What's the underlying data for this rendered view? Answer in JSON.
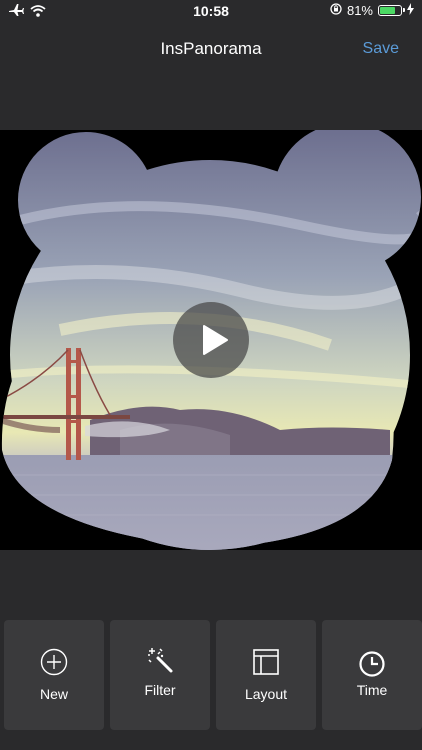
{
  "status_bar": {
    "time": "10:58",
    "battery_percent": "81%",
    "battery_level": 0.81,
    "icons": [
      "airplane-icon",
      "wifi-icon",
      "orientation-lock-icon",
      "battery-icon",
      "charging-bolt-icon"
    ]
  },
  "nav": {
    "title": "InsPanorama",
    "save_label": "Save"
  },
  "canvas": {
    "mask_shape": "bear-head",
    "play_icon": "play-icon"
  },
  "toolbar": {
    "new_label": "New",
    "filter_label": "Filter",
    "layout_label": "Layout",
    "time_label": "Time",
    "icons": [
      "plus-circle-icon",
      "magic-wand-icon",
      "layout-icon",
      "clock-icon"
    ]
  },
  "colors": {
    "background": "#2a2a2c",
    "tile": "#3a3a3c",
    "accent": "#5b9bd8",
    "battery": "#4cd964"
  }
}
